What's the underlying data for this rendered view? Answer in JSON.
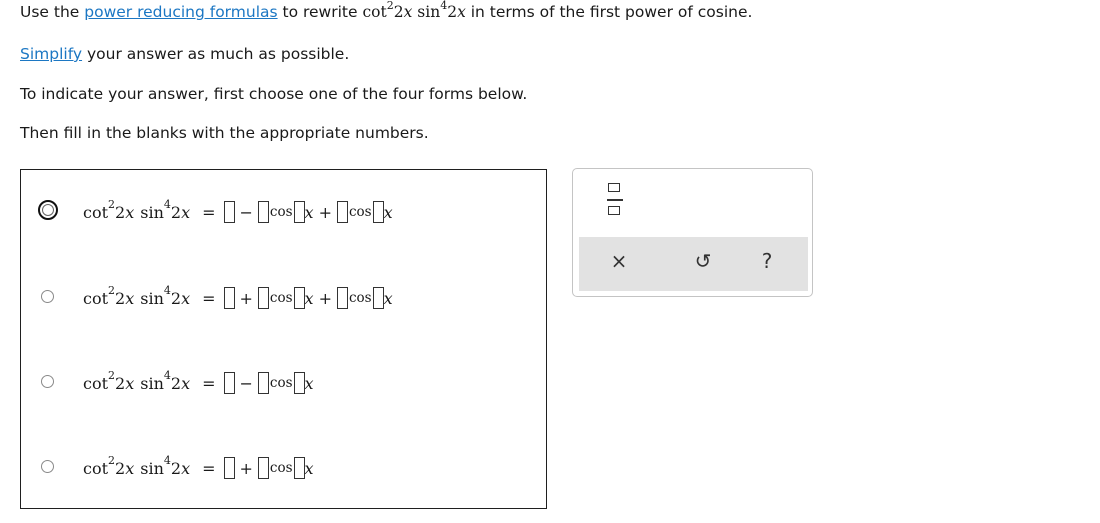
{
  "instructions": {
    "line1_prefix": "Use the ",
    "line1_link": "power reducing formulas",
    "line1_middle": " to rewrite ",
    "line1_suffix": " in terms of the first power of cosine.",
    "line2_link": "Simplify",
    "line2_suffix": " your answer as much as possible.",
    "line3": "To indicate your answer, first choose one of the four forms below.",
    "line4": "Then fill in the blanks with the appropriate numbers."
  },
  "expression": {
    "cot": "cot",
    "sin": "sin",
    "cot_exp": "2",
    "sin_exp": "4",
    "arg_coef": "2",
    "var": "x"
  },
  "form_symbols": {
    "equals": "=",
    "minus": "−",
    "plus": "+",
    "cos": "cos"
  },
  "choices": [
    {
      "selected": true,
      "ops": [
        "−",
        "+"
      ],
      "cos_terms": 2
    },
    {
      "selected": false,
      "ops": [
        "+",
        "+"
      ],
      "cos_terms": 2
    },
    {
      "selected": false,
      "ops": [
        "−"
      ],
      "cos_terms": 1
    },
    {
      "selected": false,
      "ops": [
        "+"
      ],
      "cos_terms": 1
    }
  ],
  "toolbox": {
    "fraction_icon": "fraction-icon",
    "clear": "×",
    "undo": "↺",
    "help": "?"
  }
}
